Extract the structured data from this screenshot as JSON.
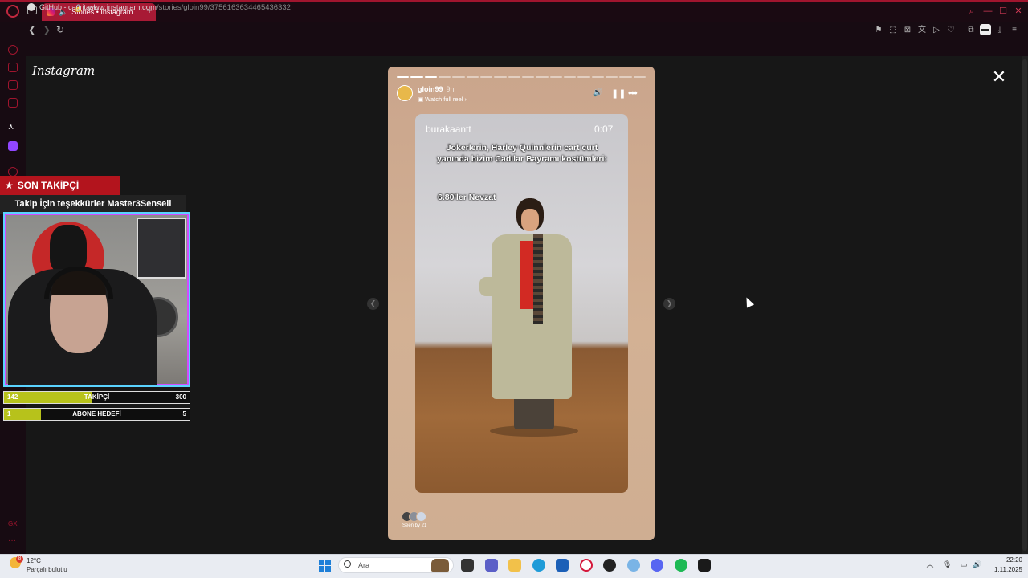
{
  "browser": {
    "tab_title": "Stories • Instagram",
    "new_tab_label": "+",
    "url_host": "www.instagram.com",
    "url_path": "/stories/gloin99/3756163634465436332",
    "bookmark_label": "GitHub - cagritask...",
    "minimize_label": "—",
    "maximize_label": "☐",
    "close_label": "✕",
    "back_label": "❮",
    "forward_label": "❯",
    "reload_label": "↻"
  },
  "instagram": {
    "logo": "Instagram",
    "close_label": "✕"
  },
  "story": {
    "username": "gloin99",
    "time_ago": "9h",
    "sub_label": "Watch full reel ›",
    "progress_total": 18,
    "progress_done": 3,
    "seen_label": "Seen by 21",
    "reel": {
      "username": "burakaantt",
      "timestamp": "0:07",
      "caption": "Jokerlerin, Harley Quinnlerin cart curt yanında bizim Cadılar Bayramı kostümleri:",
      "caption2": "6.80'ler Nevzat"
    }
  },
  "stream_overlay": {
    "banner_label": "SON TAKİPÇİ",
    "thanks_text": "Takip İçin teşekkürler Master3Senseii",
    "follower_goal": {
      "label": "TAKİPÇİ",
      "current": "142",
      "target": "300",
      "fraction": 0.47
    },
    "sub_goal": {
      "label": "ABONE HEDEFİ",
      "current": "1",
      "target": "5",
      "fraction": 0.2
    }
  },
  "taskbar": {
    "weather_temp": "12°C",
    "weather_desc": "Parçalı bulutlu",
    "weather_badge": "8",
    "search_placeholder": "Ara",
    "time": "22:20",
    "date": "1.11.2025"
  },
  "colors": {
    "accent": "#a81a35",
    "banner_red": "#b3141d",
    "goal_fill": "#b7c21b"
  }
}
